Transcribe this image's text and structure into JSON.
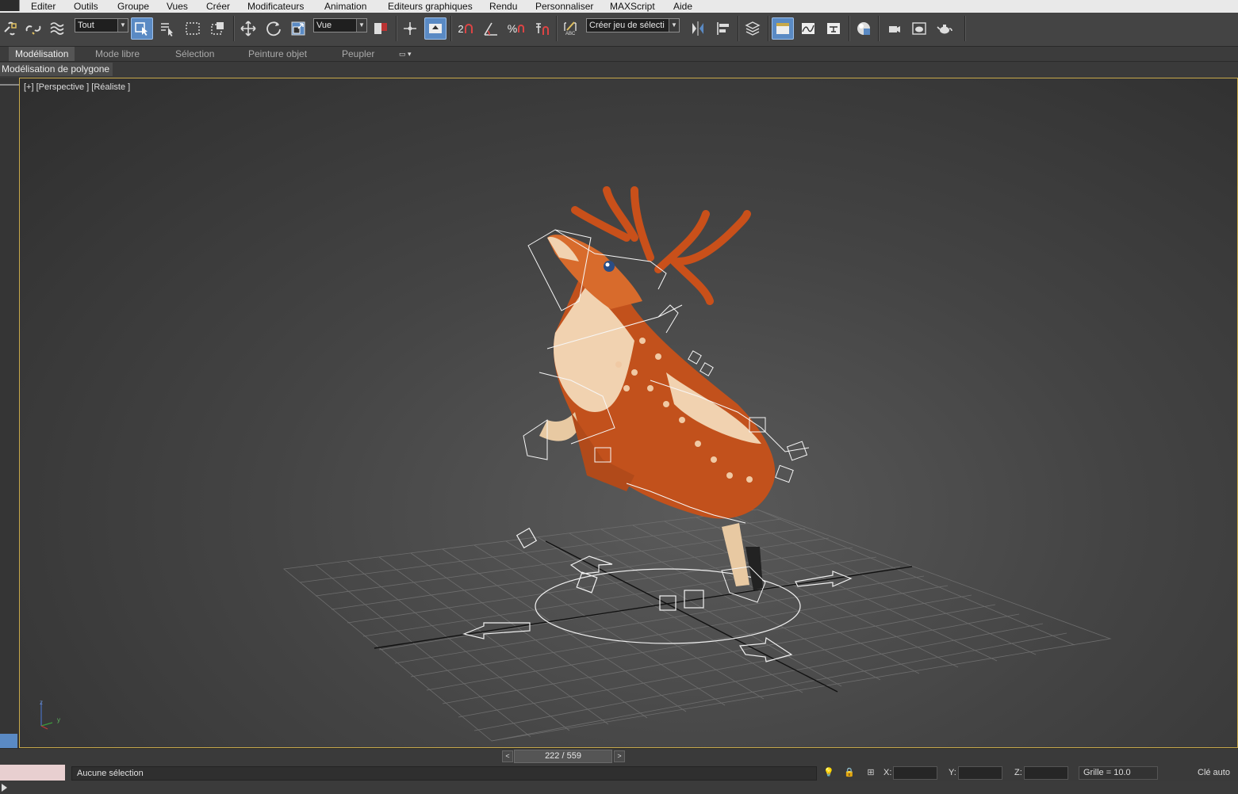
{
  "menu": {
    "items": [
      "Editer",
      "Outils",
      "Groupe",
      "Vues",
      "Créer",
      "Modificateurs",
      "Animation",
      "Editeurs graphiques",
      "Rendu",
      "Personnaliser",
      "MAXScript",
      "Aide"
    ]
  },
  "toolbar": {
    "filter_select": "Tout",
    "coord_select": "Vue",
    "selection_set_placeholder": "Créer jeu de sélecti",
    "snap_label": "2",
    "percent_snap_label": "%",
    "abc_label": "ABC"
  },
  "ribbon": {
    "tabs": [
      "Modélisation",
      "Mode libre",
      "Sélection",
      "Peinture objet",
      "Peupler"
    ],
    "active_tab": "Modélisation",
    "panel_label": "Modélisation de polygone"
  },
  "viewport": {
    "label": "[+] [Perspective ] [Réaliste ]",
    "axis_z": "z",
    "axis_y": "y"
  },
  "timeline": {
    "frame_text": "222 / 559",
    "prev": "<",
    "next": ">"
  },
  "status": {
    "message": "Aucune sélection",
    "x_label": "X:",
    "y_label": "Y:",
    "z_label": "Z:",
    "grid_text": "Grille = 10.0",
    "auto_key": "Clé auto"
  },
  "colors": {
    "accent": "#5a8ac4",
    "viewport_border": "#c8a94a",
    "deer_body": "#c2511c",
    "deer_belly": "#f1d2b0",
    "antler": "#c9501a"
  }
}
